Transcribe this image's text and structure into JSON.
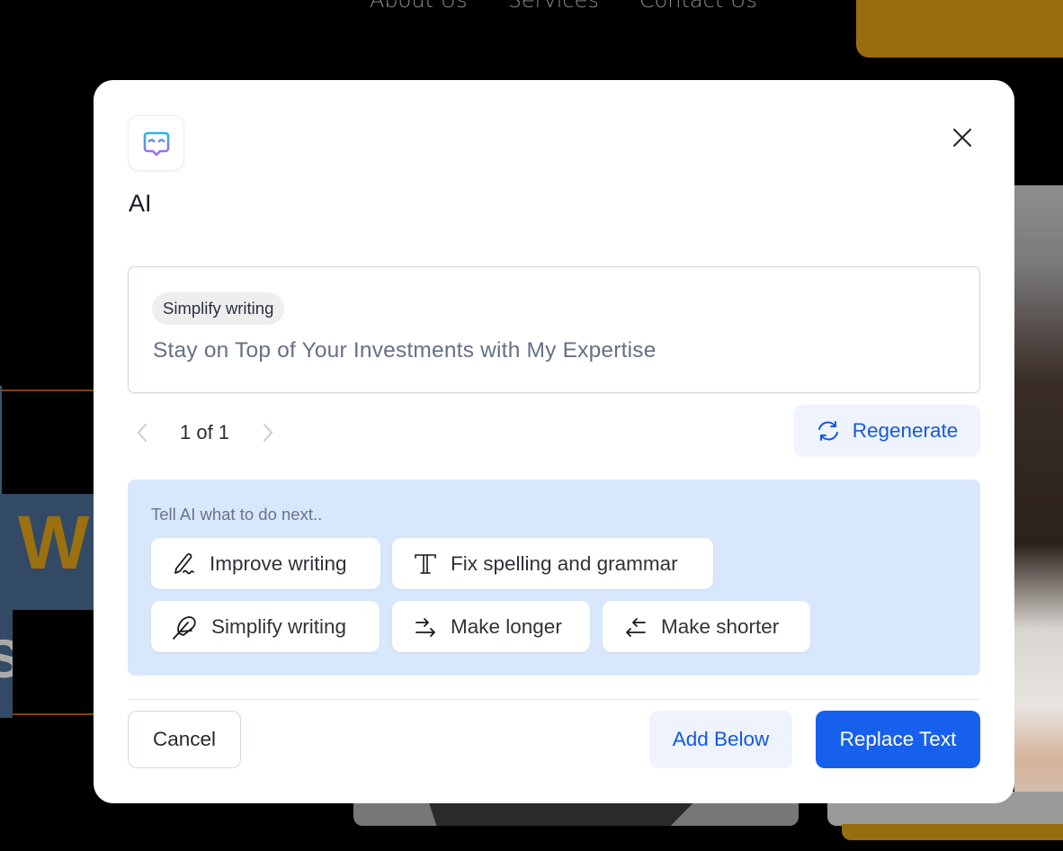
{
  "background": {
    "nav_items": [
      "About Us",
      "Services",
      "Contact Us"
    ],
    "colors": {
      "gold": "#986d0e",
      "panel_blue": "#324a65"
    },
    "panel_letter": "W",
    "panel_letter2": "S"
  },
  "modal": {
    "icon": "ai-robot-icon",
    "title": "AI",
    "close_icon": "close-icon",
    "result": {
      "action_chip": "Simplify writing",
      "text": "Stay on Top of Your Investments with My Expertise"
    },
    "pager": {
      "text": "1 of 1",
      "prev_icon": "chevron-left-icon",
      "next_icon": "chevron-right-icon"
    },
    "regenerate": {
      "label": "Regenerate",
      "icon": "refresh-icon"
    },
    "suggestions": {
      "label": "Tell AI what to do next..",
      "options": [
        {
          "label": "Improve writing",
          "icon": "pen-icon"
        },
        {
          "label": "Fix spelling and grammar",
          "icon": "typography-icon"
        },
        {
          "label": "Simplify writing",
          "icon": "feather-icon"
        },
        {
          "label": "Make longer",
          "icon": "arrows-right-icon"
        },
        {
          "label": "Make shorter",
          "icon": "arrows-left-icon"
        }
      ]
    },
    "footer": {
      "cancel": "Cancel",
      "add_below": "Add Below",
      "replace": "Replace Text"
    },
    "colors": {
      "primary": "#1760ee",
      "primary_soft": "#eef3fd",
      "suggest_bg": "#d9e7fc",
      "text_muted": "#667085"
    }
  }
}
